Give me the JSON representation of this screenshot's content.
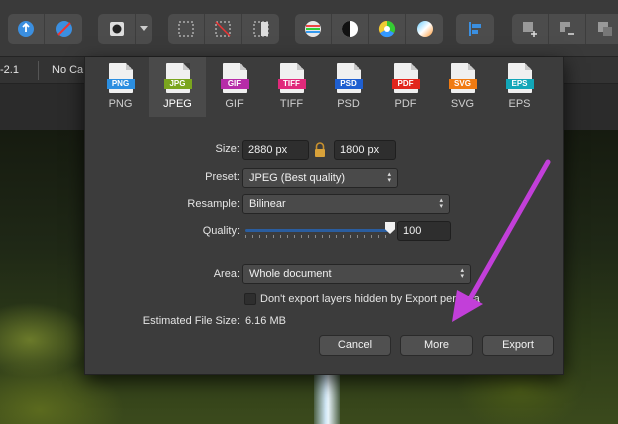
{
  "context_bar": {
    "left_fragment": "-2.1",
    "camera_fragment": "No Ca"
  },
  "format_tabs": [
    {
      "label": "PNG",
      "badge": "PNG",
      "color": "#2b8ee0"
    },
    {
      "label": "JPEG",
      "badge": "JPG",
      "color": "#7aa51e",
      "active": true
    },
    {
      "label": "GIF",
      "badge": "GIF",
      "color": "#b62ca8"
    },
    {
      "label": "TIFF",
      "badge": "TIFF",
      "color": "#e0297a"
    },
    {
      "label": "PSD",
      "badge": "PSD",
      "color": "#1f5fd0"
    },
    {
      "label": "PDF",
      "badge": "PDF",
      "color": "#e2261d"
    },
    {
      "label": "SVG",
      "badge": "SVG",
      "color": "#f07b12"
    },
    {
      "label": "EPS",
      "badge": "EPS",
      "color": "#12a6b8"
    }
  ],
  "size": {
    "label": "Size:",
    "width": "2880 px",
    "height": "1800 px"
  },
  "preset": {
    "label": "Preset:",
    "value": "JPEG (Best quality)"
  },
  "resample": {
    "label": "Resample:",
    "value": "Bilinear"
  },
  "quality": {
    "label": "Quality:",
    "value": "100",
    "level": 1.0
  },
  "area": {
    "label": "Area:",
    "value": "Whole document"
  },
  "hidden_layers": {
    "label": "Don't export layers hidden by Export persona",
    "checked": false
  },
  "file_size": {
    "label": "Estimated File Size:",
    "value": "6.16 MB"
  },
  "buttons": {
    "cancel": "Cancel",
    "more": "More",
    "export": "Export"
  },
  "annotation": {
    "color": "#c23fd9"
  }
}
